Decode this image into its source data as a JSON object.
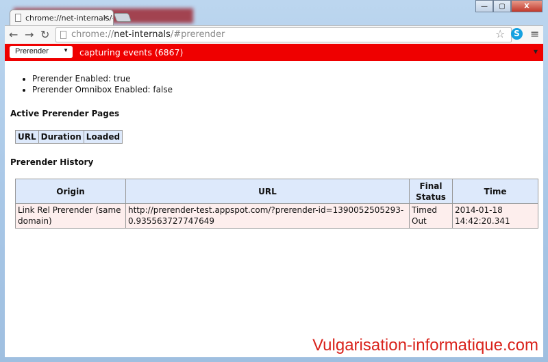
{
  "tab": {
    "title": "chrome://net-internals/#p",
    "close": "×"
  },
  "window": {
    "minimize": "—",
    "maximize": "▢",
    "close": "X"
  },
  "toolbar": {
    "back": "←",
    "forward": "→",
    "reload": "↻",
    "url_scheme": "chrome://",
    "url_host": "net-internals",
    "url_path": "/#prerender",
    "star": "☆",
    "skype": "S",
    "menu": "≡"
  },
  "redbar": {
    "select_value": "Prerender",
    "status": "capturing events (6867)",
    "color": "#ef0000"
  },
  "status": [
    "Prerender Enabled: true",
    "Prerender Omnibox Enabled: false"
  ],
  "active": {
    "heading": "Active Prerender Pages",
    "headers": [
      "URL",
      "Duration",
      "Loaded"
    ]
  },
  "history": {
    "heading": "Prerender History",
    "headers": [
      "Origin",
      "URL",
      "Final Status",
      "Time"
    ],
    "rows": [
      [
        "Link Rel Prerender (same domain)",
        "http://prerender-test.appspot.com/?prerender-id=1390052505293-0.935563727747649",
        "Timed Out",
        "2014-01-18 14:42:20.341"
      ]
    ]
  },
  "watermark": "Vulgarisation-informatique.com"
}
